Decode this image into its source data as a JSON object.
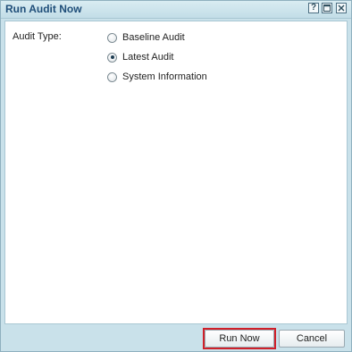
{
  "window": {
    "title": "Run Audit Now",
    "help_label": "?"
  },
  "form": {
    "audit_type_label": "Audit Type:",
    "options": [
      {
        "label": "Baseline Audit",
        "checked": false
      },
      {
        "label": "Latest Audit",
        "checked": true
      },
      {
        "label": "System Information",
        "checked": false
      }
    ]
  },
  "footer": {
    "run_label": "Run Now",
    "cancel_label": "Cancel",
    "highlight_color": "#d0202a"
  },
  "colors": {
    "title_text": "#1f4e79",
    "frame": "#c9e1ea"
  }
}
